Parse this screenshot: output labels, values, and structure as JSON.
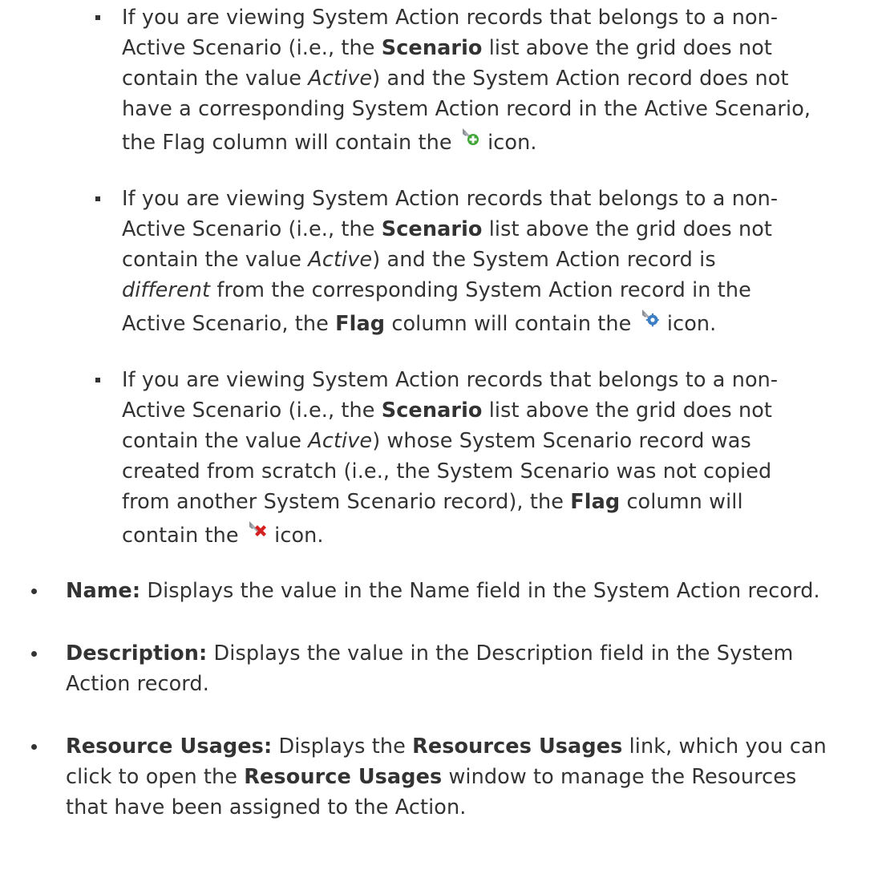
{
  "items": {
    "sub1": {
      "l1_a": "If you are viewing System Action records that belongs to a non-",
      "l2_a": "Active Scenario (i.e., the ",
      "l2_b": "Scenario",
      "l2_c": " list above the grid does not",
      "l3_a": "contain the value ",
      "l3_b": "Active",
      "l3_c": ") and the System Action record does not",
      "l4": "have a corresponding System Action record in the Active Scenario,",
      "l5_a": "the Flag column will contain the",
      "l5_b": "icon.",
      "icon": "wrench-plus-icon"
    },
    "sub2": {
      "l1_a": "If you are viewing System Action records that belongs to a non-",
      "l2_a": "Active Scenario (i.e., the ",
      "l2_b": "Scenario",
      "l2_c": " list above the grid does not",
      "l3_a": "contain the value ",
      "l3_b": "Active",
      "l3_c": ") and the System Action record is",
      "l4_a": "different",
      "l4_b": " from the corresponding System Action record in the",
      "l5_a": "Active Scenario, the ",
      "l5_b": "Flag",
      "l5_c": " column will contain the",
      "l5_d": "icon.",
      "icon": "wrench-gear-icon"
    },
    "sub3": {
      "l1_a": "If you are viewing System Action records that belongs to a non-",
      "l2_a": "Active Scenario (i.e., the ",
      "l2_b": "Scenario",
      "l2_c": " list above the grid does not",
      "l3_a": "contain the value ",
      "l3_b": "Active",
      "l3_c": ") whose System Scenario record was",
      "l4": "created from scratch (i.e., the System Scenario was not copied",
      "l5_a": "from another System Scenario record), the ",
      "l5_b": "Flag",
      "l5_c": " column will",
      "l6_a": "contain the",
      "l6_b": "icon.",
      "icon": "wrench-x-icon"
    },
    "name": {
      "label": "Name:",
      "text": " Displays the value in the Name field in the System Action record."
    },
    "description": {
      "label": "Description:",
      "l1": " Displays the value in the Description field in the System",
      "l2": "Action record."
    },
    "resource": {
      "label": "Resource Usages:",
      "l1_a": " Displays the ",
      "l1_b": "Resources Usages",
      "l1_c": " link, which you can",
      "l2_a": "click to open the ",
      "l2_b": "Resource Usages",
      "l2_c": " window to manage the Resources",
      "l3": "that have been assigned to the Action."
    }
  }
}
